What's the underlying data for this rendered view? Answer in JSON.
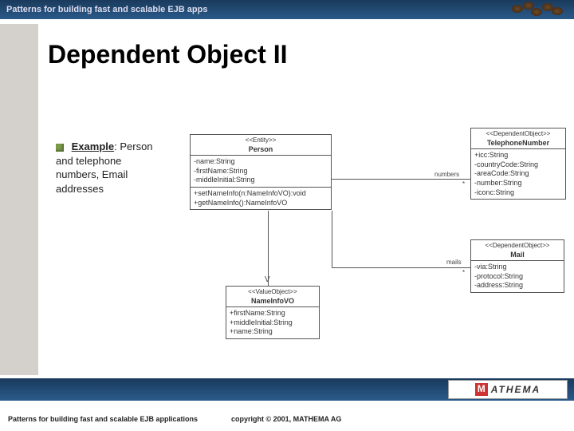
{
  "header": {
    "title": "Patterns for building fast and scalable EJB apps"
  },
  "slide": {
    "title": "Dependent Object II"
  },
  "bullet": {
    "label": "Example",
    "text": ": Person and telephone numbers, Email addresses"
  },
  "uml": {
    "person": {
      "stereo": "<<Entity>>",
      "name": "Person",
      "attrs": [
        "-name:String",
        "-firstName:String",
        "-middleInitial:String"
      ],
      "ops": [
        "+setNameInfo(n:NameInfoVO):void",
        "+getNameInfo():NameInfoVO"
      ]
    },
    "phone": {
      "stereo": "<<DependentObject>>",
      "name": "TelephoneNumber",
      "attrs": [
        "+icc:String",
        "-countryCode:String",
        "-areaCode:String",
        "-number:String",
        "-iconc:String"
      ]
    },
    "mail": {
      "stereo": "<<DependentObject>>",
      "name": "Mail",
      "attrs": [
        "-via:String",
        "-protocol:String",
        "-address:String"
      ]
    },
    "nameinfo": {
      "stereo": "<<ValueObject>>",
      "name": "NameInfoVO",
      "attrs": [
        "+firstName:String",
        "+middleInitial:String",
        "+name:String"
      ]
    },
    "assoc": {
      "numbers": "numbers",
      "mails": "mails",
      "star": "*"
    }
  },
  "footer": {
    "left": "Patterns for building fast and scalable EJB applications",
    "right": "copyright © 2001, MATHEMA AG",
    "logo": "ATHEMA"
  }
}
